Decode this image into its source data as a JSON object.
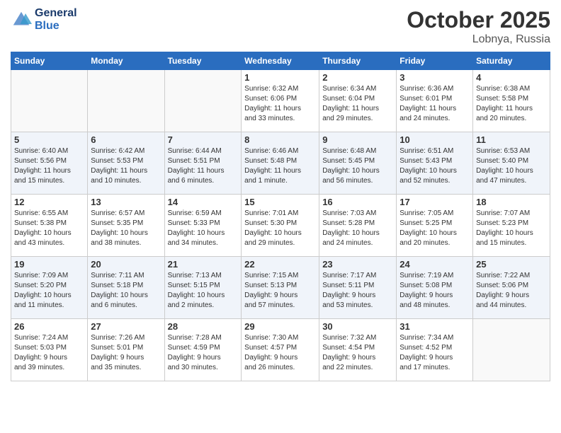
{
  "header": {
    "logo_line1": "General",
    "logo_line2": "Blue",
    "title": "October 2025",
    "subtitle": "Lobnya, Russia"
  },
  "days_of_week": [
    "Sunday",
    "Monday",
    "Tuesday",
    "Wednesday",
    "Thursday",
    "Friday",
    "Saturday"
  ],
  "weeks": [
    {
      "days": [
        {
          "num": "",
          "detail": ""
        },
        {
          "num": "",
          "detail": ""
        },
        {
          "num": "",
          "detail": ""
        },
        {
          "num": "1",
          "detail": "Sunrise: 6:32 AM\nSunset: 6:06 PM\nDaylight: 11 hours\nand 33 minutes."
        },
        {
          "num": "2",
          "detail": "Sunrise: 6:34 AM\nSunset: 6:04 PM\nDaylight: 11 hours\nand 29 minutes."
        },
        {
          "num": "3",
          "detail": "Sunrise: 6:36 AM\nSunset: 6:01 PM\nDaylight: 11 hours\nand 24 minutes."
        },
        {
          "num": "4",
          "detail": "Sunrise: 6:38 AM\nSunset: 5:58 PM\nDaylight: 11 hours\nand 20 minutes."
        }
      ]
    },
    {
      "days": [
        {
          "num": "5",
          "detail": "Sunrise: 6:40 AM\nSunset: 5:56 PM\nDaylight: 11 hours\nand 15 minutes."
        },
        {
          "num": "6",
          "detail": "Sunrise: 6:42 AM\nSunset: 5:53 PM\nDaylight: 11 hours\nand 10 minutes."
        },
        {
          "num": "7",
          "detail": "Sunrise: 6:44 AM\nSunset: 5:51 PM\nDaylight: 11 hours\nand 6 minutes."
        },
        {
          "num": "8",
          "detail": "Sunrise: 6:46 AM\nSunset: 5:48 PM\nDaylight: 11 hours\nand 1 minute."
        },
        {
          "num": "9",
          "detail": "Sunrise: 6:48 AM\nSunset: 5:45 PM\nDaylight: 10 hours\nand 56 minutes."
        },
        {
          "num": "10",
          "detail": "Sunrise: 6:51 AM\nSunset: 5:43 PM\nDaylight: 10 hours\nand 52 minutes."
        },
        {
          "num": "11",
          "detail": "Sunrise: 6:53 AM\nSunset: 5:40 PM\nDaylight: 10 hours\nand 47 minutes."
        }
      ]
    },
    {
      "days": [
        {
          "num": "12",
          "detail": "Sunrise: 6:55 AM\nSunset: 5:38 PM\nDaylight: 10 hours\nand 43 minutes."
        },
        {
          "num": "13",
          "detail": "Sunrise: 6:57 AM\nSunset: 5:35 PM\nDaylight: 10 hours\nand 38 minutes."
        },
        {
          "num": "14",
          "detail": "Sunrise: 6:59 AM\nSunset: 5:33 PM\nDaylight: 10 hours\nand 34 minutes."
        },
        {
          "num": "15",
          "detail": "Sunrise: 7:01 AM\nSunset: 5:30 PM\nDaylight: 10 hours\nand 29 minutes."
        },
        {
          "num": "16",
          "detail": "Sunrise: 7:03 AM\nSunset: 5:28 PM\nDaylight: 10 hours\nand 24 minutes."
        },
        {
          "num": "17",
          "detail": "Sunrise: 7:05 AM\nSunset: 5:25 PM\nDaylight: 10 hours\nand 20 minutes."
        },
        {
          "num": "18",
          "detail": "Sunrise: 7:07 AM\nSunset: 5:23 PM\nDaylight: 10 hours\nand 15 minutes."
        }
      ]
    },
    {
      "days": [
        {
          "num": "19",
          "detail": "Sunrise: 7:09 AM\nSunset: 5:20 PM\nDaylight: 10 hours\nand 11 minutes."
        },
        {
          "num": "20",
          "detail": "Sunrise: 7:11 AM\nSunset: 5:18 PM\nDaylight: 10 hours\nand 6 minutes."
        },
        {
          "num": "21",
          "detail": "Sunrise: 7:13 AM\nSunset: 5:15 PM\nDaylight: 10 hours\nand 2 minutes."
        },
        {
          "num": "22",
          "detail": "Sunrise: 7:15 AM\nSunset: 5:13 PM\nDaylight: 9 hours\nand 57 minutes."
        },
        {
          "num": "23",
          "detail": "Sunrise: 7:17 AM\nSunset: 5:11 PM\nDaylight: 9 hours\nand 53 minutes."
        },
        {
          "num": "24",
          "detail": "Sunrise: 7:19 AM\nSunset: 5:08 PM\nDaylight: 9 hours\nand 48 minutes."
        },
        {
          "num": "25",
          "detail": "Sunrise: 7:22 AM\nSunset: 5:06 PM\nDaylight: 9 hours\nand 44 minutes."
        }
      ]
    },
    {
      "days": [
        {
          "num": "26",
          "detail": "Sunrise: 7:24 AM\nSunset: 5:03 PM\nDaylight: 9 hours\nand 39 minutes."
        },
        {
          "num": "27",
          "detail": "Sunrise: 7:26 AM\nSunset: 5:01 PM\nDaylight: 9 hours\nand 35 minutes."
        },
        {
          "num": "28",
          "detail": "Sunrise: 7:28 AM\nSunset: 4:59 PM\nDaylight: 9 hours\nand 30 minutes."
        },
        {
          "num": "29",
          "detail": "Sunrise: 7:30 AM\nSunset: 4:57 PM\nDaylight: 9 hours\nand 26 minutes."
        },
        {
          "num": "30",
          "detail": "Sunrise: 7:32 AM\nSunset: 4:54 PM\nDaylight: 9 hours\nand 22 minutes."
        },
        {
          "num": "31",
          "detail": "Sunrise: 7:34 AM\nSunset: 4:52 PM\nDaylight: 9 hours\nand 17 minutes."
        },
        {
          "num": "",
          "detail": ""
        }
      ]
    }
  ]
}
